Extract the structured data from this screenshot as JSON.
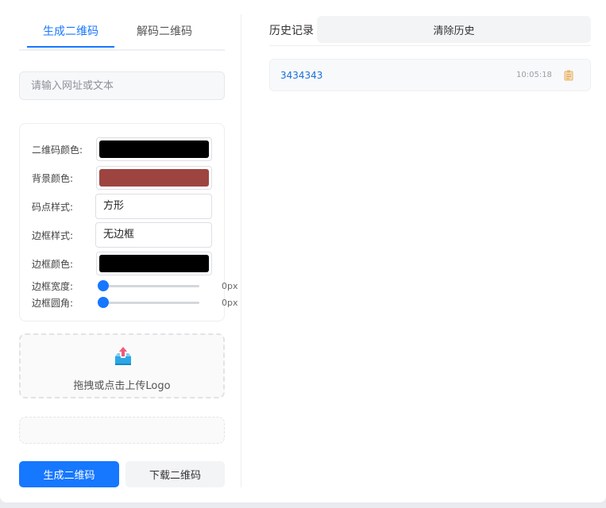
{
  "tabs": [
    {
      "label": "生成二维码",
      "active": true
    },
    {
      "label": "解码二维码",
      "active": false
    }
  ],
  "input": {
    "placeholder": "请输入网址或文本",
    "value": ""
  },
  "settings": {
    "qr_color": {
      "label": "二维码颜色:",
      "value": "#000000"
    },
    "bg_color": {
      "label": "背景颜色:",
      "value": "#9d4441"
    },
    "dot_style": {
      "label": "码点样式:",
      "value": "方形"
    },
    "border_style": {
      "label": "边框样式:",
      "value": "无边框"
    },
    "border_color": {
      "label": "边框颜色:",
      "value": "#000000"
    },
    "border_width": {
      "label": "边框宽度:",
      "value": "0px",
      "level": 0
    },
    "border_radius": {
      "label": "边框圆角:",
      "value": "0px",
      "level": 0
    }
  },
  "upload": {
    "label": "拖拽或点击上传Logo",
    "icon": "upload-icon"
  },
  "buttons": {
    "generate": "生成二维码",
    "download": "下载二维码"
  },
  "history": {
    "title": "历史记录",
    "clear_label": "清除历史",
    "items": [
      {
        "text": "3434343",
        "time": "10:05:18",
        "icon": "copy-icon"
      }
    ]
  },
  "colors": {
    "accent": "#1677ff"
  }
}
